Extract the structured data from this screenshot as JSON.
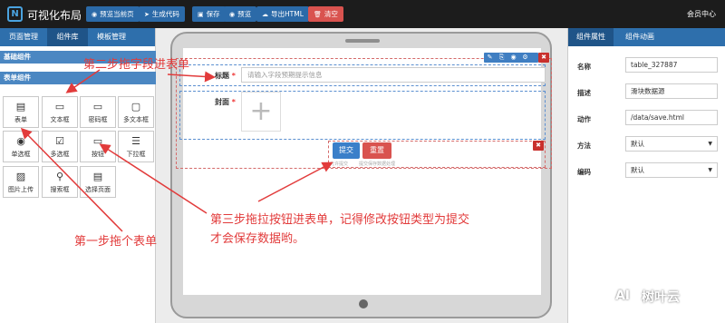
{
  "app": {
    "title": "可视化布局",
    "logo_letter": "N",
    "member_center": "会员中心"
  },
  "toolbar": {
    "preview_current": "预览当前页",
    "generate_code": "生成代码",
    "save": "保存",
    "preview": "预览",
    "export_html": "导出HTML",
    "clear": "清空"
  },
  "left": {
    "tabs": [
      "页面管理",
      "组件库",
      "模板管理"
    ],
    "active_tab": "组件库",
    "section_basic": "基础组件",
    "section_form": "表单组件",
    "components": [
      {
        "label": "表单",
        "icon": "form-icon",
        "glyph": "▤"
      },
      {
        "label": "文本框",
        "icon": "textbox-icon",
        "glyph": "▭"
      },
      {
        "label": "密码框",
        "icon": "password-icon",
        "glyph": "▭"
      },
      {
        "label": "多文本框",
        "icon": "textarea-icon",
        "glyph": "▢"
      },
      {
        "label": "单选框",
        "icon": "radio-icon",
        "glyph": "◉"
      },
      {
        "label": "多选框",
        "icon": "checkbox-icon",
        "glyph": "☑"
      },
      {
        "label": "按钮",
        "icon": "button-icon",
        "glyph": "▭"
      },
      {
        "label": "下拉框",
        "icon": "select-icon",
        "glyph": "☰"
      },
      {
        "label": "图片上传",
        "icon": "image-upload-icon",
        "glyph": "▨"
      },
      {
        "label": "搜索框",
        "icon": "search-icon",
        "glyph": "⚲"
      },
      {
        "label": "选择页面",
        "icon": "select-page-icon",
        "glyph": "▤"
      }
    ]
  },
  "canvas": {
    "field_title_label": "标题",
    "field_title_placeholder": "请输入字段预期提示信息",
    "field_cover_label": "封面",
    "upload_plus": "+",
    "submit_label": "提交",
    "reset_label": "重置",
    "required_mark": "*",
    "small_hint_1": "允许提交",
    "small_hint_2": "提交保存数据处理"
  },
  "right": {
    "tabs": [
      "组件属性",
      "组件动画"
    ],
    "active_tab": "组件属性",
    "props": [
      {
        "label": "名称",
        "value": "table_327887",
        "type": "input"
      },
      {
        "label": "描述",
        "value": "滑块数据源",
        "type": "input"
      },
      {
        "label": "动作",
        "value": "/data/save.html",
        "type": "input"
      },
      {
        "label": "方法",
        "value": "默认",
        "type": "select"
      },
      {
        "label": "编码",
        "value": "默认",
        "type": "select"
      }
    ]
  },
  "annotations": {
    "step1": "第一步拖个表单",
    "step2": "第二步拖字段进表单",
    "step3_line1": "第三步拖拉按钮进表单，记得修改按钮类型为提交",
    "step3_line2": "才会保存数据哟。"
  },
  "watermark": {
    "logo": "AI",
    "text": "树叶云"
  },
  "colors": {
    "accent": "#2e6fac",
    "danger": "#d9534f",
    "annotation": "#e23b3b"
  }
}
